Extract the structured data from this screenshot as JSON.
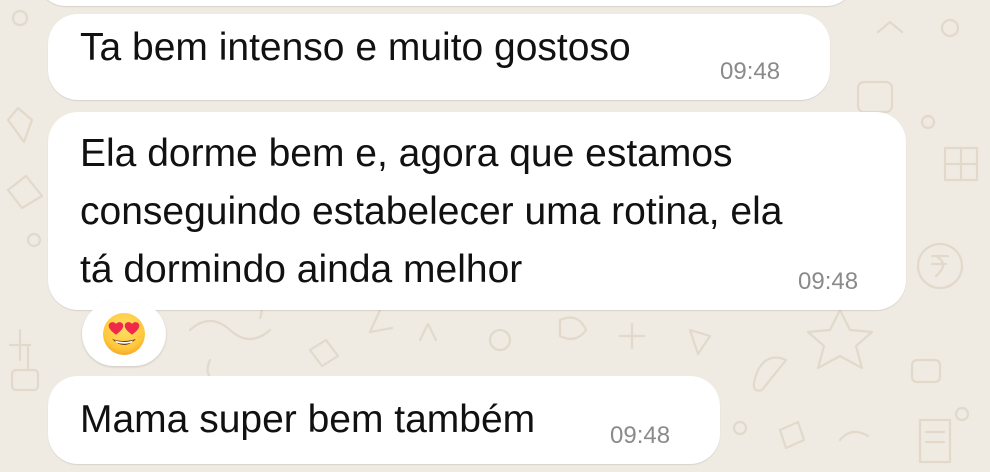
{
  "messages": [
    {
      "text": "Ta bem intenso e muito gostoso",
      "time": "09:48"
    },
    {
      "lines": [
        "Ela dorme bem e, agora que estamos",
        "conseguindo estabelecer uma rotina, ela",
        "tá dormindo ainda melhor"
      ],
      "time": "09:48",
      "reaction_icon": "smiling-face-with-heart-eyes-icon"
    },
    {
      "text": "Mama super bem também",
      "time": "09:48"
    }
  ],
  "colors": {
    "wallpaper": "#efeae2",
    "bubble": "#ffffff",
    "text": "#111111",
    "timestamp": "#8a8a8a",
    "wallpaper_doodle": "#e2d9cb"
  }
}
